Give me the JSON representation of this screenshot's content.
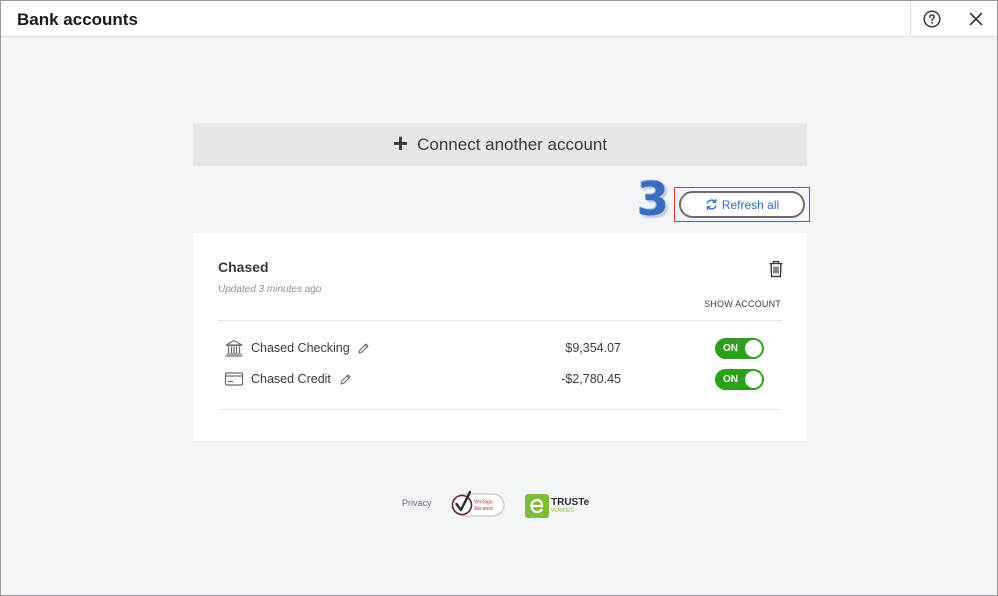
{
  "window": {
    "title": "Bank accounts",
    "icons": {
      "help": "help-circle-icon",
      "close": "close-icon"
    }
  },
  "connect": {
    "label": "Connect another account",
    "icon": "plus-icon"
  },
  "annotation": {
    "step_number": "3",
    "color": "#3b6dbf",
    "highlight_color": "#e03030"
  },
  "refresh": {
    "label": "Refresh all",
    "icon": "refresh-icon"
  },
  "bank": {
    "name": "Chased",
    "updated": "Updated 3 minutes ago",
    "show_account_label": "SHOW ACCOUNT",
    "delete_icon": "trash-icon",
    "accounts": [
      {
        "name": "Chased Checking",
        "amount": "$9,354.07",
        "toggle": "ON",
        "icon": "bank-building-icon"
      },
      {
        "name": "Chased Credit",
        "amount": "-$2,780.45",
        "toggle": "ON",
        "icon": "credit-card-icon"
      }
    ]
  },
  "footer": {
    "privacy_label": "Privacy",
    "verisign": {
      "line1": "VeriSign",
      "line2": "Secured"
    },
    "truste": {
      "name": "TRUSTe",
      "sub": "VERIFIED"
    }
  },
  "colors": {
    "toggle_on": "#2ca01c",
    "link_blue": "#2f6fc4",
    "background": "#f4f5f8"
  }
}
